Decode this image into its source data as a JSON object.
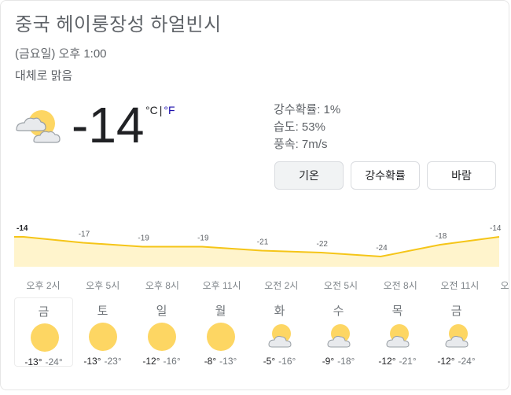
{
  "location": "중국 헤이룽장성 하얼빈시",
  "time": "(금요일) 오후 1:00",
  "condition": "대체로 맑음",
  "current": {
    "temp": "-14",
    "unit_c": "°C",
    "unit_sep": "|",
    "unit_f": "°F",
    "icon": "partly-cloudy-icon"
  },
  "details": {
    "precip": "강수확률: 1%",
    "humidity": "습도: 53%",
    "wind": "풍속: 7m/s"
  },
  "tabs": [
    "기온",
    "강수확률",
    "바람"
  ],
  "chart_data": {
    "type": "area",
    "values": [
      -14,
      -17,
      -19,
      -19,
      -21,
      -22,
      -24,
      -18,
      -14
    ],
    "labels": [
      "-14",
      "-17",
      "-19",
      "-19",
      "-21",
      "-22",
      "-24",
      "-18",
      "-14"
    ],
    "x": [
      "오후 2시",
      "오후 5시",
      "오후 8시",
      "오후 11시",
      "오전 2시",
      "오전 5시",
      "오전 8시",
      "오전 11시",
      "오"
    ],
    "line_color": "#f5c518",
    "fill_color": "#fff4cc"
  },
  "hours": [
    "오후 2시",
    "오후 5시",
    "오후 8시",
    "오후 11시",
    "오전 2시",
    "오전 5시",
    "오전 8시",
    "오전 11시",
    "오"
  ],
  "days": [
    {
      "name": "금",
      "icon": "sunny-icon",
      "hi": "-13°",
      "lo": "-24°"
    },
    {
      "name": "토",
      "icon": "sunny-icon",
      "hi": "-13°",
      "lo": "-23°"
    },
    {
      "name": "일",
      "icon": "sunny-icon",
      "hi": "-12°",
      "lo": "-16°"
    },
    {
      "name": "월",
      "icon": "sunny-icon",
      "hi": "-8°",
      "lo": "-13°"
    },
    {
      "name": "화",
      "icon": "partly-cloudy-icon",
      "hi": "-5°",
      "lo": "-16°"
    },
    {
      "name": "수",
      "icon": "partly-cloudy-icon",
      "hi": "-9°",
      "lo": "-18°"
    },
    {
      "name": "목",
      "icon": "partly-cloudy-icon",
      "hi": "-12°",
      "lo": "-21°"
    },
    {
      "name": "금",
      "icon": "partly-cloudy-icon",
      "hi": "-12°",
      "lo": "-24°"
    }
  ],
  "colors": {
    "sun": "#fdd663",
    "cloud": "#dadce0",
    "link": "#1a0dab"
  }
}
